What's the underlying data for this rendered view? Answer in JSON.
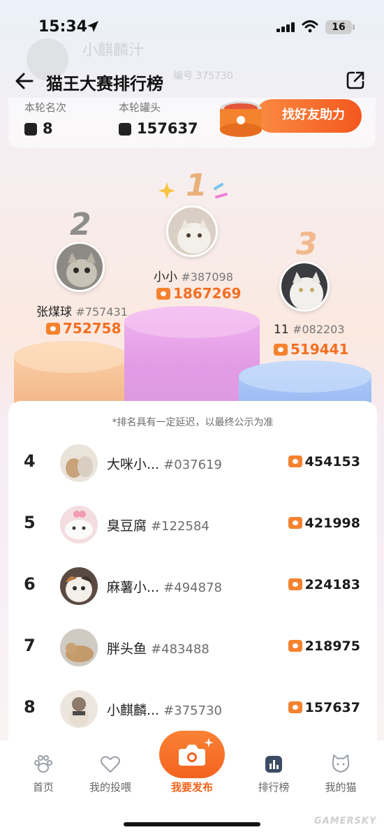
{
  "status_bar": {
    "time": "15:34",
    "battery": "16"
  },
  "background_ghost": {
    "username": "小麒麟汁",
    "number": "编号 375730"
  },
  "nav": {
    "title": "猫王大赛排行榜"
  },
  "stats": {
    "rank_label": "本轮名次",
    "rank_value": "8",
    "cans_label": "本轮罐头",
    "cans_value": "157637",
    "help_button": "找好友助力"
  },
  "podium": [
    {
      "rank": "1",
      "name": "小小",
      "id": "#387098",
      "score": "1867269"
    },
    {
      "rank": "2",
      "name": "张煤球",
      "id": "#757431",
      "score": "752758"
    },
    {
      "rank": "3",
      "name": "11",
      "id": "#082203",
      "score": "519441"
    }
  ],
  "list": {
    "notice": "*排名具有一定延迟，以最终公示为准",
    "rows": [
      {
        "rank": "4",
        "name": "大咪小...",
        "id": "#037619",
        "score": "454153"
      },
      {
        "rank": "5",
        "name": "臭豆腐",
        "id": "#122584",
        "score": "421998"
      },
      {
        "rank": "6",
        "name": "麻薯小...",
        "id": "#494878",
        "score": "224183"
      },
      {
        "rank": "7",
        "name": "胖头鱼",
        "id": "#483488",
        "score": "218975"
      },
      {
        "rank": "8",
        "name": "小麒麟...",
        "id": "#375730",
        "score": "157637"
      }
    ]
  },
  "tabs": [
    {
      "label": "首页",
      "icon": "paw-icon"
    },
    {
      "label": "我的投喂",
      "icon": "heart-icon"
    },
    {
      "label": "我要发布",
      "icon": "camera-icon"
    },
    {
      "label": "排行榜",
      "icon": "ranking-icon"
    },
    {
      "label": "我的猫",
      "icon": "cat-icon"
    }
  ],
  "watermark": "GAMERSKY",
  "colors": {
    "accent_orange": "#f36f22",
    "podium_1": "#e39be6",
    "podium_2": "#f5bd90",
    "podium_3": "#9ebdf4"
  }
}
